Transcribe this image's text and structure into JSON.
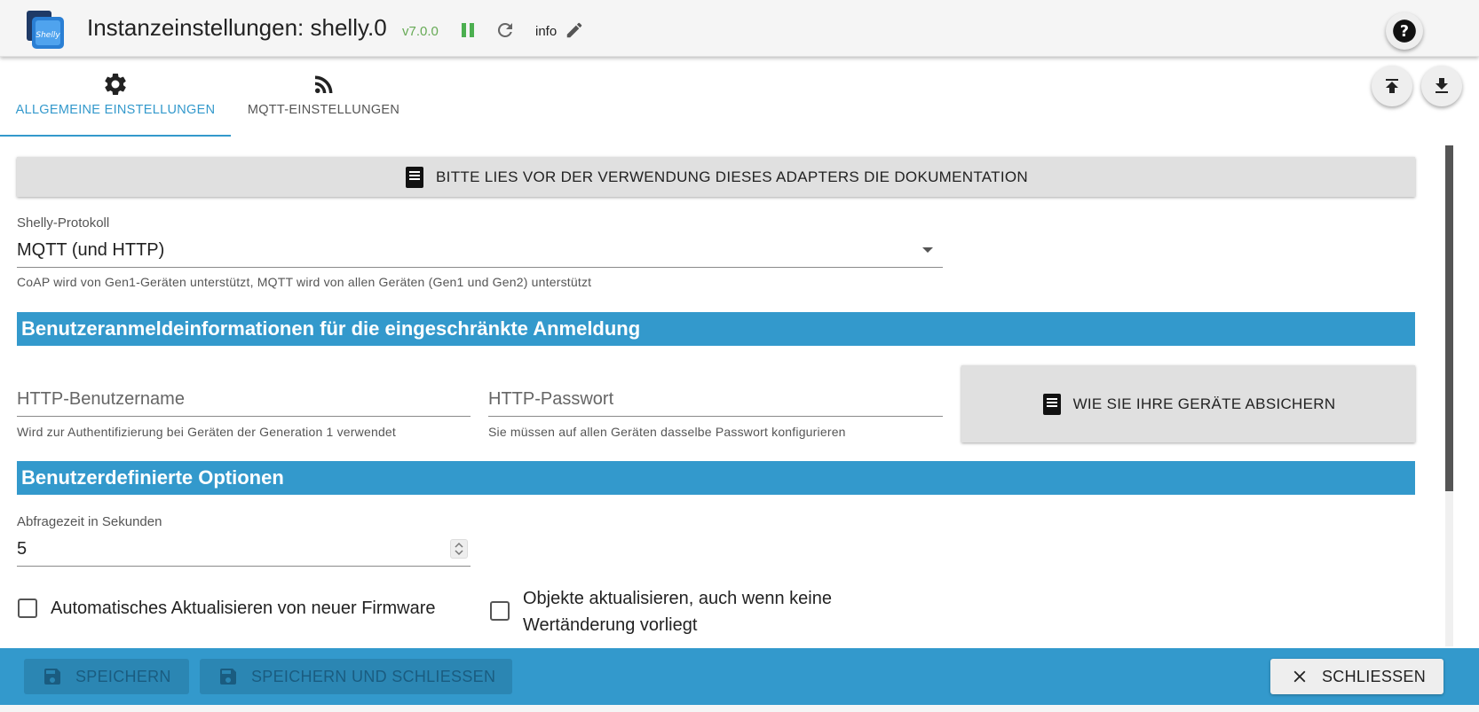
{
  "header": {
    "title": "Instanzeinstellungen: shelly.0",
    "version": "v7.0.0",
    "log_level": "info",
    "icons": [
      "shelly-logo",
      "pause-icon",
      "reload-icon",
      "edit-icon",
      "help-icon"
    ]
  },
  "tabs": [
    {
      "label": "ALLGEMEINE EINSTELLUNGEN",
      "icon": "gear-icon",
      "active": true
    },
    {
      "label": "MQTT-EINSTELLUNGEN",
      "icon": "rss-icon",
      "active": false
    }
  ],
  "content": {
    "doc_button": "BITTE LIES VOR DER VERWENDUNG DIESES ADAPTERS DIE DOKUMENTATION",
    "protocol": {
      "label": "Shelly-Protokoll",
      "value": "MQTT (und HTTP)",
      "helper": "CoAP wird von Gen1-Geräten unterstützt, MQTT wird von allen Geräten (Gen1 und Gen2) unterstützt"
    },
    "section_credentials": "Benutzeranmeldeinformationen für die eingeschränkte Anmeldung",
    "http_username": {
      "placeholder": "HTTP-Benutzername",
      "helper": "Wird zur Authentifizierung bei Geräten der Generation 1 verwendet"
    },
    "http_password": {
      "placeholder": "HTTP-Passwort",
      "helper": "Sie müssen auf allen Geräten dasselbe Passwort konfigurieren"
    },
    "secure_button": "WIE SIE IHRE GERÄTE ABSICHERN",
    "section_custom": "Benutzerdefinierte Optionen",
    "polling": {
      "label": "Abfragezeit in Sekunden",
      "value": "5"
    },
    "auto_update": {
      "label": "Automatisches Aktualisieren von neuer Firmware",
      "checked": false
    },
    "update_objects": {
      "label_line1": "Objekte aktualisieren, auch wenn keine",
      "label_line2": "Wertänderung vorliegt",
      "checked": false
    }
  },
  "footer": {
    "save": "SPEICHERN",
    "save_close": "SPEICHERN UND SCHLIESSEN",
    "close": "SCHLIESSEN"
  },
  "colors": {
    "accent": "#3399cc",
    "version": "#66aa55",
    "pause": "#4caf50"
  }
}
